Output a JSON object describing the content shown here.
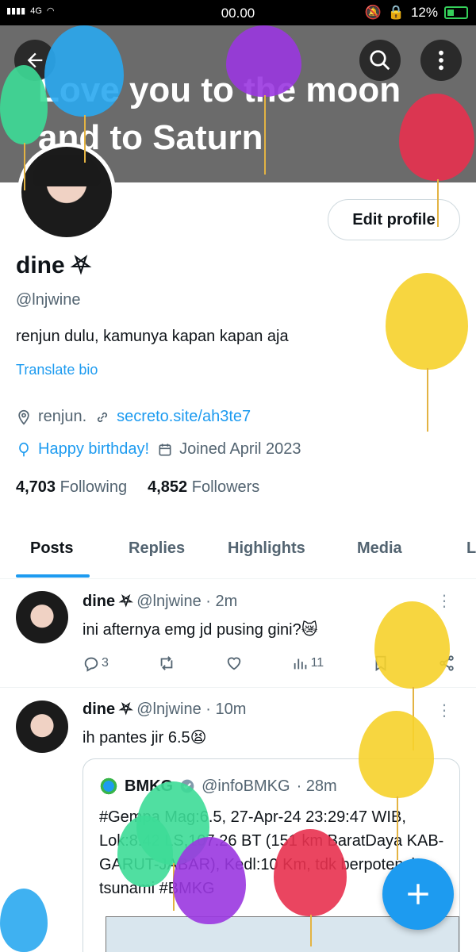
{
  "status_bar": {
    "signal": "4G",
    "time": "00.00",
    "battery": "12%"
  },
  "banner": {
    "text": "Love you to the moon and to Saturn"
  },
  "profile": {
    "edit_button": "Edit profile",
    "name": "dine",
    "name_emoji": "⛧",
    "handle": "@lnjwine",
    "bio": "renjun dulu, kamunya kapan kapan aja",
    "translate": "Translate bio",
    "location": "renjun.",
    "link": "secreto.site/ah3te7",
    "birthday": "Happy birthday!",
    "joined": "Joined April 2023",
    "following_count": "4,703",
    "following_label": "Following",
    "followers_count": "4,852",
    "followers_label": "Followers"
  },
  "tabs": [
    "Posts",
    "Replies",
    "Highlights",
    "Media",
    "L"
  ],
  "tweets": [
    {
      "name": "dine",
      "emoji": "⛧",
      "handle": "@lnjwine",
      "time": "· 2m",
      "text": "ini afternya emg jd pusing gini?😿",
      "replies": "3",
      "views": "11"
    },
    {
      "name": "dine",
      "emoji": "⛧",
      "handle": "@lnjwine",
      "time": "· 10m",
      "text": "ih pantes jir 6.5😫",
      "quote": {
        "name": "BMKG",
        "handle": "@infoBMKG",
        "time": "· 28m",
        "text": "#Gempa Mag:6.5, 27-Apr-24 23:29:47 WIB, Lok:8.42 LS,107.26 BT (151 km BaratDaya KAB-GARUT-JABAR), Kedl:10 Km, tdk berpotensi tsunami #BMKG"
      }
    }
  ],
  "colors": {
    "accent": "#1d9bf0",
    "text": "#0f1419",
    "muted": "#536471"
  }
}
